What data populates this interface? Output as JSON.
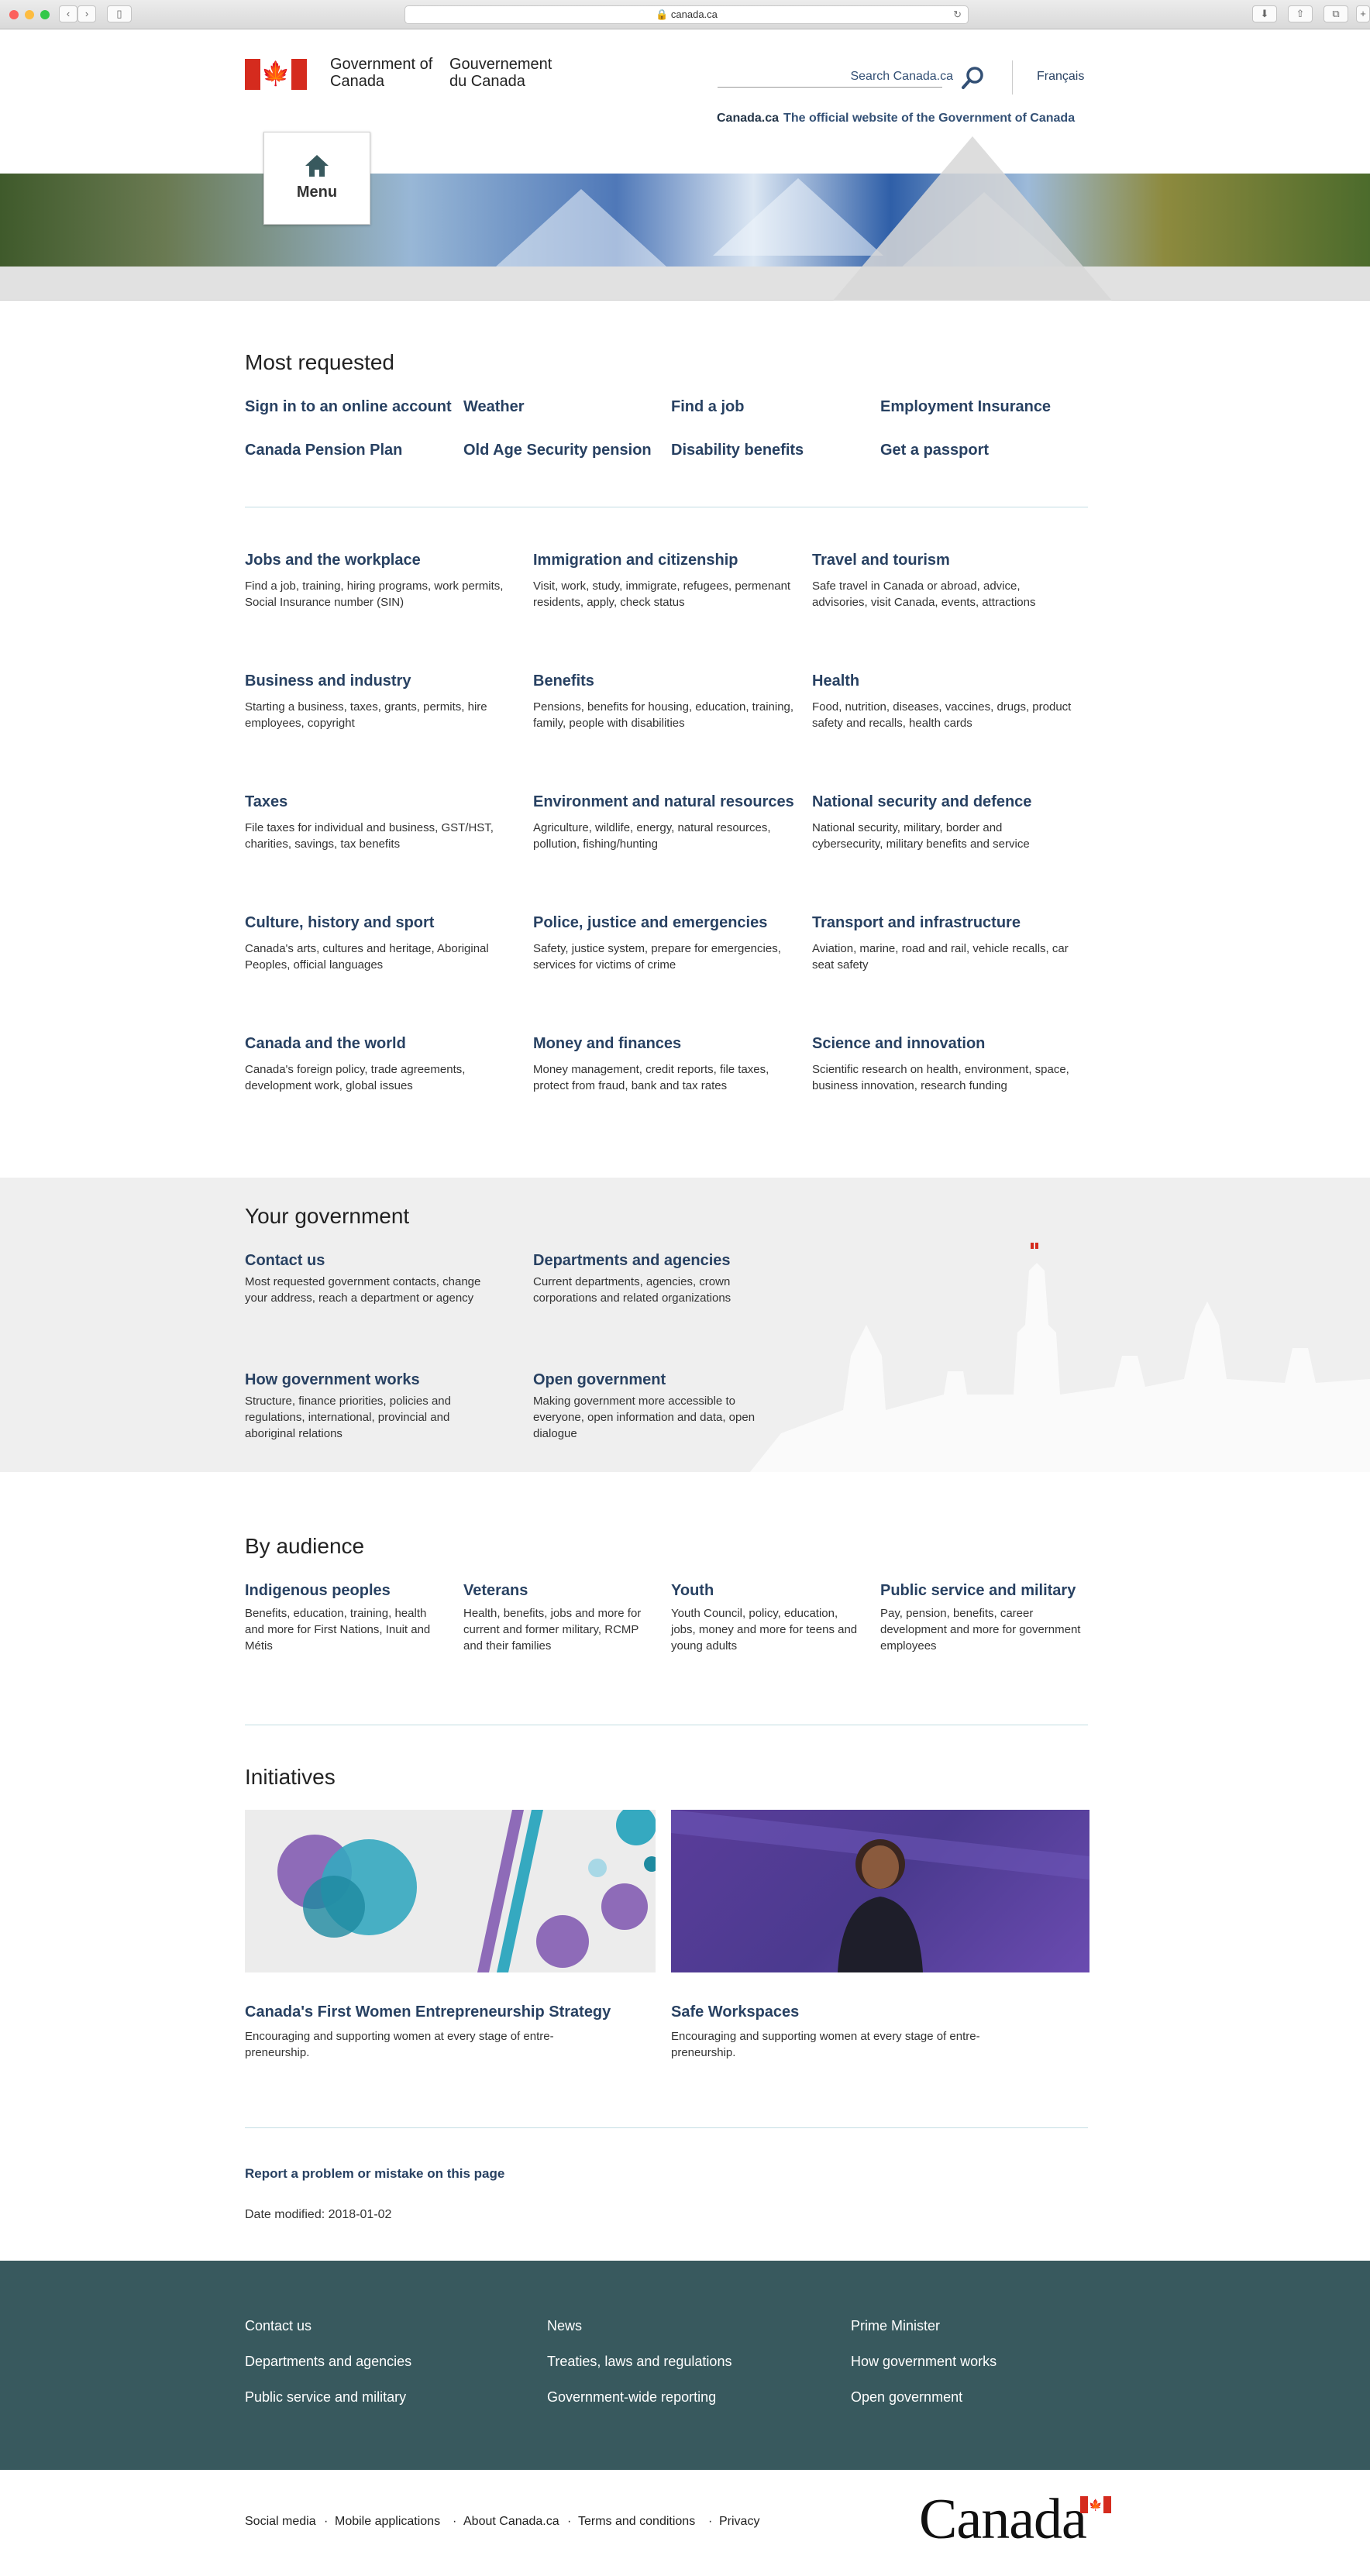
{
  "browser": {
    "url": "canada.ca"
  },
  "header": {
    "sig_en": "Government of Canada",
    "sig_fr": "Gouvernement du Canada",
    "search_placeholder": "Search Canada.ca",
    "language_link": "Français",
    "breadcrumb_home": "Canada.ca",
    "breadcrumb_tagline": "The official website of the Government of Canada",
    "menu_label": "Menu"
  },
  "most_requested": {
    "title": "Most requested",
    "links": [
      "Sign in to an online account",
      "Weather",
      "Find a job",
      "Employment Insurance",
      "Canada Pension Plan",
      "Old Age Security pension",
      "Disability benefits",
      "Get a passport"
    ]
  },
  "topics": [
    {
      "title": "Jobs and the workplace",
      "desc": "Find a job, training, hiring programs, work permits, Social Insurance number (SIN)"
    },
    {
      "title": "Immigration and citizenship",
      "desc": "Visit, work, study, immigrate, refugees, permenant residents, apply, check status"
    },
    {
      "title": "Travel and tourism",
      "desc": "Safe travel in Canada or abroad, advice, advisories, visit Canada, events, attractions"
    },
    {
      "title": "Business and industry",
      "desc": "Starting a business, taxes, grants, permits, hire employees, copyright"
    },
    {
      "title": "Benefits",
      "desc": "Pensions, benefits for housing, education, training, family, people with disabilities"
    },
    {
      "title": "Health",
      "desc": "Food, nutrition, diseases, vaccines, drugs, product safety and recalls, health cards"
    },
    {
      "title": "Taxes",
      "desc": "File taxes for individual and business, GST/HST, charities, savings, tax benefits"
    },
    {
      "title": "Environment and natural resources",
      "desc": "Agriculture, wildlife, energy, natural resources, pollution, fishing/hunting"
    },
    {
      "title": "National security and defence",
      "desc": "National security, military, border and cybersecurity, military benefits and service"
    },
    {
      "title": "Culture, history and sport",
      "desc": "Canada's arts, cultures and heritage, Aboriginal Peoples, official languages"
    },
    {
      "title": "Police, justice and emergencies",
      "desc": "Safety, justice system, prepare for emergencies, services for victims of crime"
    },
    {
      "title": "Transport and infrastructure",
      "desc": "Aviation, marine, road and rail, vehicle recalls, car seat safety"
    },
    {
      "title": "Canada and the world",
      "desc": "Canada's foreign policy, trade agreements, development work, global issues"
    },
    {
      "title": "Money and finances",
      "desc": "Money management, credit reports, file taxes, protect from fraud, bank and tax rates"
    },
    {
      "title": "Science and innovation",
      "desc": "Scientific research on health, environment, space, business innovation, research funding"
    }
  ],
  "your_government": {
    "title": "Your government",
    "items": [
      {
        "title": "Contact us",
        "desc": "Most requested government contacts, change your address, reach a department or agency"
      },
      {
        "title": "Departments and agencies",
        "desc": "Current departments, agencies, crown corporations and related organizations"
      },
      {
        "title": "How government works",
        "desc": "Structure, finance priorities, policies and regulations, international, provincial and aboriginal relations"
      },
      {
        "title": "Open government",
        "desc": "Making government more accessible to everyone, open information and data, open dialogue"
      }
    ]
  },
  "by_audience": {
    "title": "By audience",
    "items": [
      {
        "title": "Indigenous peoples",
        "desc": "Benefits, education, training, health and more for First Nations, Inuit and Métis"
      },
      {
        "title": "Veterans",
        "desc": "Health, benefits, jobs and more for current and former military, RCMP and their families"
      },
      {
        "title": "Youth",
        "desc": "Youth Council, policy, education, jobs, money and more for teens and young adults"
      },
      {
        "title": "Public service and military",
        "desc": "Pay, pension, benefits, career development and more for government employees"
      }
    ]
  },
  "initiatives": {
    "title": "Initiatives",
    "items": [
      {
        "title": "Canada's First Women Entrepreneurship Strategy",
        "desc": "Encouraging and supporting women at every stage of entre- preneurship."
      },
      {
        "title": "Safe Workspaces",
        "desc": "Encouraging and supporting women at every stage of entre- preneurship."
      }
    ]
  },
  "page_footer": {
    "report": "Report a problem or mistake on this page",
    "date_modified": "Date modified: 2018-01-02"
  },
  "footer": {
    "links": [
      "Contact us",
      "News",
      "Prime Minister",
      "Departments and agencies",
      "Treaties, laws and regulations",
      "How government works",
      "Public service and military",
      "Government-wide reporting",
      "Open government"
    ],
    "sub_links": [
      "Social media",
      "Mobile applications",
      "About Canada.ca",
      "Terms and conditions",
      "Privacy"
    ],
    "wordmark": "Canada"
  },
  "colors": {
    "link": "#284162",
    "footer_bg": "#38595e",
    "flag_red": "#d52b1e"
  }
}
